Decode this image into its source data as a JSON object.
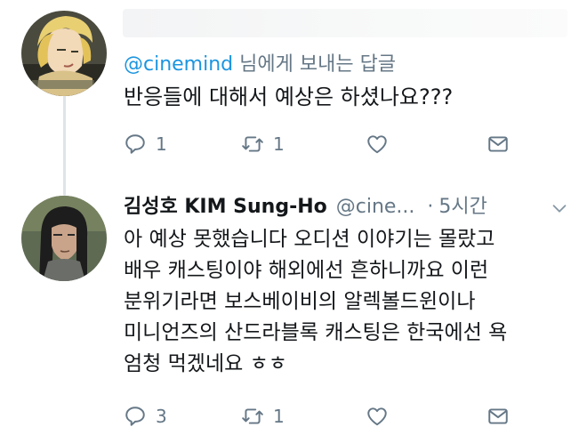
{
  "reply_tweet": {
    "reply_prefix_handle": "@cinemind",
    "reply_suffix": "님에게 보내는 답글",
    "text": "반응들에 대해서 예상은 하셨나요???",
    "actions": {
      "reply_count": "1",
      "retweet_count": "1"
    }
  },
  "main_tweet": {
    "display_name": "김성호 KIM Sung-Ho",
    "handle": "@cine...",
    "separator": "·",
    "time": "5시간",
    "lines": [
      "아 예상 못했습니다 오디션 이야기는 몰랐고",
      "배우 캐스팅이야 해외에선 흔하니까요 이런",
      "분위기라면 보스베이비의 알렉볼드윈이나",
      "미니언즈의 산드라블록 캐스팅은 한국에선 욕",
      "엄청 먹겠네요 ㅎㅎ"
    ],
    "actions": {
      "reply_count": "3",
      "retweet_count": "1"
    }
  },
  "icons": {
    "reply": "reply-icon",
    "retweet": "retweet-icon",
    "like": "heart-icon",
    "dm": "envelope-icon",
    "more": "chevron-down-icon"
  },
  "colors": {
    "link_blue": "#1b95e0",
    "secondary_gray": "#657786",
    "text": "#14171a"
  }
}
